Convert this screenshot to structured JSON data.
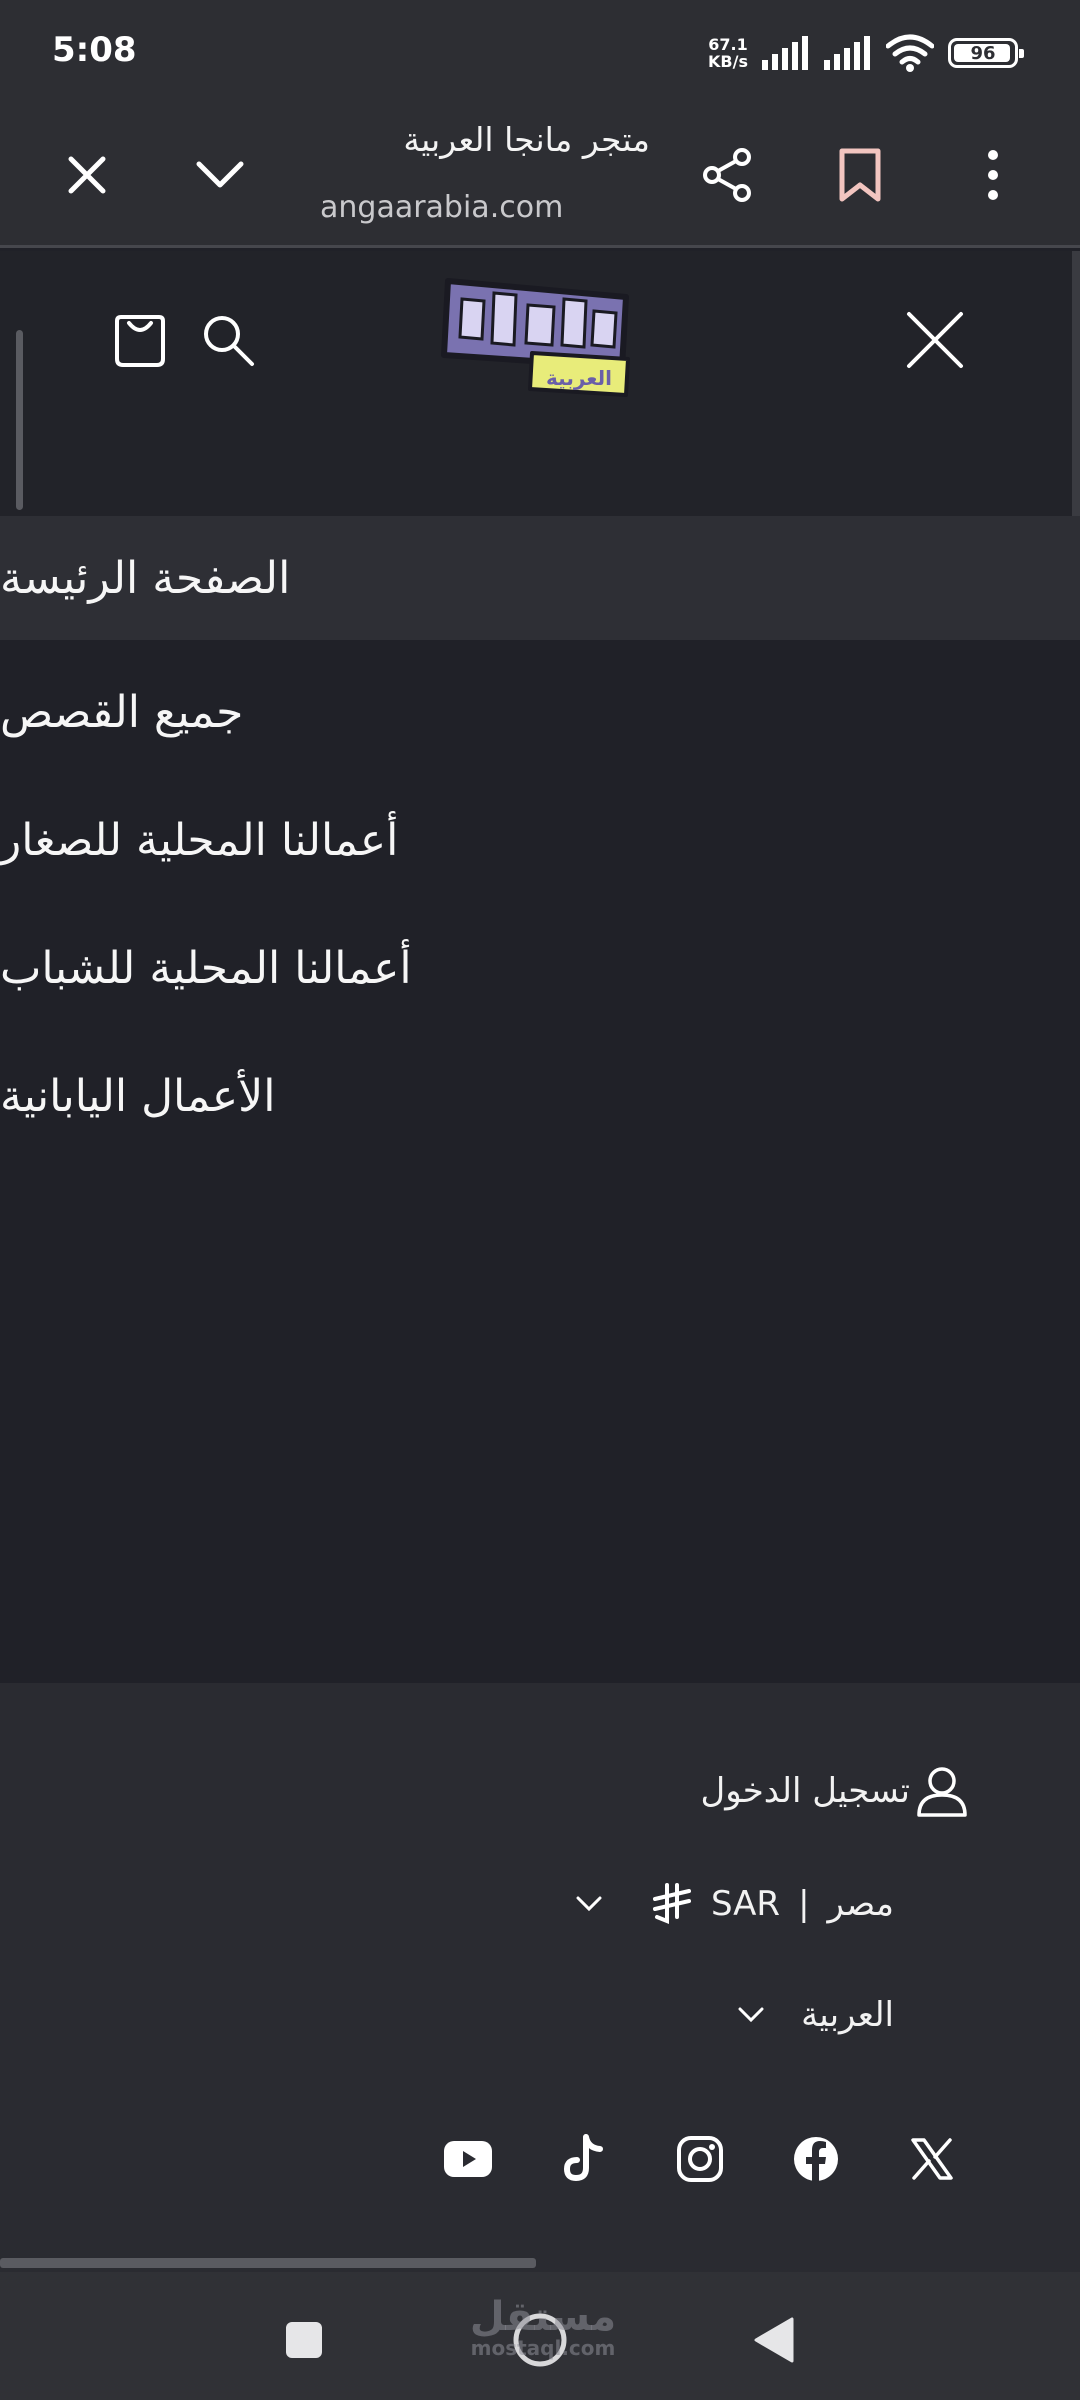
{
  "status_bar": {
    "time": "5:08",
    "net_speed_value": "67.1",
    "net_speed_unit": "KB/s",
    "battery": "96",
    "battery_level": 0.96
  },
  "browser": {
    "page_title": "متجر مانجا العربية",
    "url": "angaarabia.com",
    "icons": [
      "close-icon",
      "chevron-down-icon",
      "share-icon",
      "bookmark-icon",
      "more-vert-icon"
    ]
  },
  "header": {
    "logo_text_main": "مانجا",
    "logo_text_sub": "العربية",
    "icons": [
      "bag-icon",
      "search-icon",
      "close-icon"
    ]
  },
  "menu": {
    "items": [
      {
        "label": "الصفحة الرئيسة",
        "active": true
      },
      {
        "label": "جميع القصص",
        "active": false
      },
      {
        "label": "أعمالنا المحلية للصغار",
        "active": false
      },
      {
        "label": "أعمالنا المحلية للشباب",
        "active": false
      },
      {
        "label": "الأعمال اليابانية",
        "active": false
      }
    ]
  },
  "footer": {
    "login_label": "تسجيل الدخول",
    "country": "مصر",
    "separator": "|",
    "currency": "SAR",
    "language": "العربية",
    "social": [
      "x-icon",
      "facebook-icon",
      "instagram-icon",
      "tiktok-icon",
      "youtube-icon"
    ]
  },
  "watermark": {
    "arabic": "مستقل",
    "latin": "mostaql.com"
  },
  "colors": {
    "background": "#202128",
    "chrome": "#2d2e33",
    "active_item": "#2e2f35",
    "footer": "#2a2b31",
    "logo_purple": "#7a72b0",
    "logo_yellow": "#e8ec7a"
  }
}
